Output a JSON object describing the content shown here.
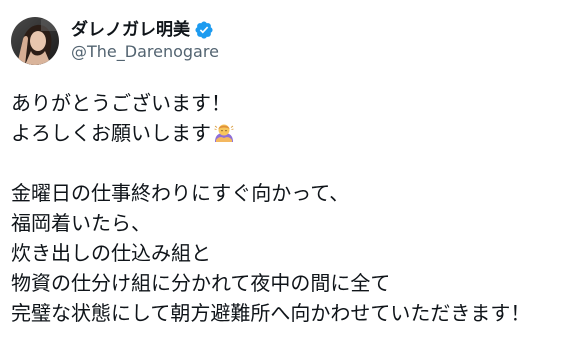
{
  "author": {
    "display_name": "ダレノガレ明美",
    "handle": "@The_Darenogare",
    "verified_color": "#1d9bf0"
  },
  "tweet": {
    "line1": "ありがとうございます！",
    "line2": "よろしくお願いします",
    "line2_emoji": "person-bowing-emoji",
    "line3": "金曜日の仕事終わりにすぐ向かって、",
    "line4": "福岡着いたら、",
    "line5": "炊き出しの仕込み組と",
    "line6": "物資の仕分け組に分かれて夜中の間に全て",
    "line7": "完璧な状態にして朝方避難所へ向かわせていただきます！"
  }
}
